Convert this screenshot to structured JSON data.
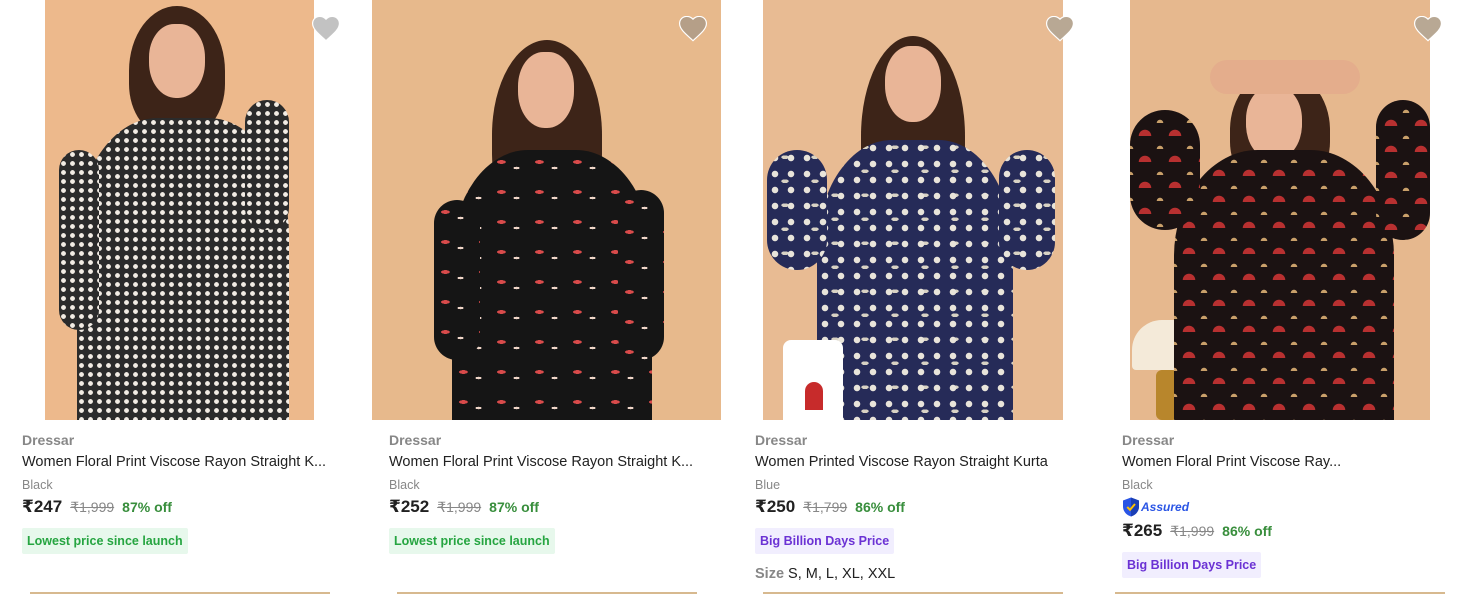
{
  "products": [
    {
      "brand": "Dressar",
      "title": "Women Floral Print Viscose Rayon Straight K...",
      "variant": "Black",
      "assured": false,
      "price": "₹247",
      "mrp": "₹1,999",
      "discount": "87% off",
      "tag": "Lowest price since launch",
      "tag_type": "lowest",
      "sizes": null,
      "image_icon": "kurta-black-white-print-image"
    },
    {
      "brand": "Dressar",
      "title": "Women Floral Print Viscose Rayon Straight K...",
      "variant": "Black",
      "assured": false,
      "price": "₹252",
      "mrp": "₹1,999",
      "discount": "87% off",
      "tag": "Lowest price since launch",
      "tag_type": "lowest",
      "sizes": null,
      "image_icon": "kurta-black-red-floral-image"
    },
    {
      "brand": "Dressar",
      "title": "Women Printed Viscose Rayon Straight Kurta",
      "variant": "Blue",
      "assured": false,
      "price": "₹250",
      "mrp": "₹1,799",
      "discount": "86% off",
      "tag": "Big Billion Days Price",
      "tag_type": "bbd",
      "sizes": {
        "label": "Size",
        "values": "S, M, L, XL, XXL"
      },
      "image_icon": "kurta-navy-floral-image"
    },
    {
      "brand": "Dressar",
      "title": "Women Floral Print Viscose Ray...",
      "variant": "Black",
      "assured": true,
      "assured_label": "Assured",
      "price": "₹265",
      "mrp": "₹1,999",
      "discount": "86% off",
      "tag": "Big Billion Days Price",
      "tag_type": "bbd",
      "sizes": null,
      "image_icon": "kurta-black-red-fan-print-image"
    }
  ],
  "colors": {
    "discount_green": "#388e3c",
    "lowest_tag_bg": "#e7f8ec",
    "lowest_tag_text": "#26a541",
    "bbd_tag_bg": "#f1eefe",
    "bbd_tag_text": "#6b32d4",
    "assured_blue": "#2a55e5",
    "wishlist_heart": "#c2c2c2",
    "muted_text": "#878787"
  }
}
